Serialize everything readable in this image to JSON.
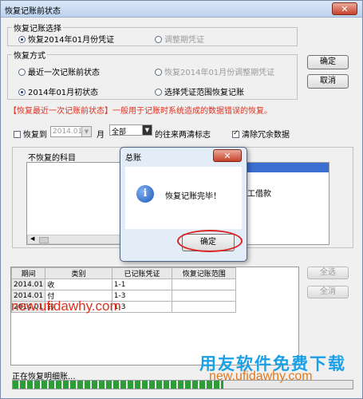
{
  "window": {
    "title": "恢复记账前状态",
    "close": "✕"
  },
  "selection_group": {
    "label": "恢复记账选择",
    "option_restore_month": "恢复2014年01月份凭证",
    "option_adjust_period": "调整期凭证"
  },
  "method_group": {
    "label": "恢复方式",
    "option_recent": "最近一次记账前状态",
    "option_recent_adjust": "恢复2014年01月份调整期凭证",
    "option_month_start": "2014年01月初状态",
    "option_range": "选择凭证范围恢复记账"
  },
  "buttons": {
    "ok": "确定",
    "cancel": "取消",
    "select_all": "全选",
    "clear_all": "全消"
  },
  "hint": "【恢复最近一次记账前状态】一般用于记账时系统造成的数据错误的恢复。",
  "restore_to": {
    "checkbox_label": "恢复到",
    "period_value": "2014.01",
    "month_label": "月",
    "scope_value": "全部",
    "scope_suffix": "的往来两清标志",
    "clear_redundant": "清除冗余数据"
  },
  "subjects_panel": {
    "left_label": "不恢复的科目",
    "right_item": "工借款"
  },
  "table": {
    "headers": [
      "期间",
      "类别",
      "已记账凭证",
      "恢复记账范围"
    ],
    "rows": [
      [
        "2014.01",
        "收",
        "1-1",
        ""
      ],
      [
        "2014.01",
        "付",
        "1-3",
        ""
      ],
      [
        "2014.01",
        "转",
        "1-3",
        ""
      ]
    ]
  },
  "status": {
    "text": "正在恢复明细账...",
    "progress_fraction": 0.62
  },
  "dialog": {
    "title": "总账",
    "message": "恢复记账完毕！",
    "ok": "确定",
    "close": "✕",
    "icon": "info-icon"
  },
  "watermarks": {
    "site_top": "new.ufidawhy.com",
    "brand": "用友软件免费下载",
    "site_bottom": "new.ufidawhy.com"
  },
  "colors": {
    "hint_red": "#e0301e",
    "progress_green": "#2f9c3a",
    "brand_blue": "#1aa0e6"
  }
}
